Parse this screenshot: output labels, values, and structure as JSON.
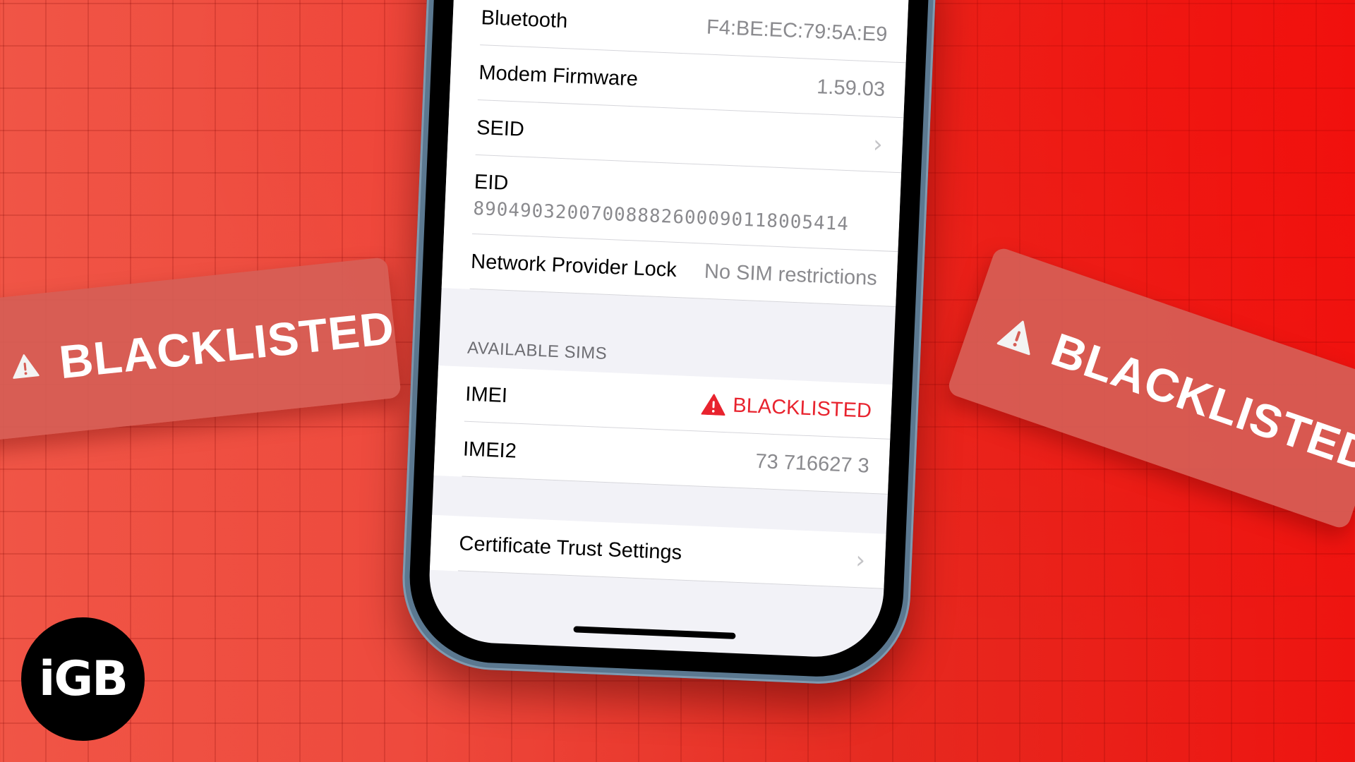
{
  "background": {
    "accent": "#ee1410",
    "grid": "red-grid"
  },
  "phone": {
    "rows_top": [
      {
        "label": "Bluetooth",
        "value": "F4:BE:EC:79:5A:E9"
      },
      {
        "label": "Modem Firmware",
        "value": "1.59.03"
      },
      {
        "label": "SEID",
        "value": "",
        "chevron": true
      }
    ],
    "eid": {
      "label": "EID",
      "value": "89049032007008882600090118005414"
    },
    "network_lock": {
      "label": "Network Provider Lock",
      "value": "No SIM restrictions"
    },
    "available_sims_header": "AVAILABLE SIMS",
    "imei": {
      "label": "IMEI",
      "status": "BLACKLISTED",
      "status_color": "#e8232e"
    },
    "imei2": {
      "label": "IMEI2",
      "value": "73 716627 3"
    },
    "certificate": {
      "label": "Certificate Trust Settings"
    }
  },
  "badges": {
    "left": {
      "text": "BLACKLISTED"
    },
    "right": {
      "text": "BLACKLISTED"
    }
  },
  "logo": {
    "text": "iGB"
  },
  "icons": {
    "chevron": "›",
    "warning": "warning-triangle-icon"
  }
}
